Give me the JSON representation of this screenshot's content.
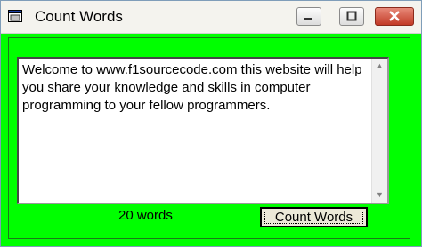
{
  "window": {
    "title": "Count Words"
  },
  "titlebar_buttons": {
    "minimize": "minimize",
    "maximize": "maximize",
    "close": "close"
  },
  "textbox": {
    "value": "Welcome to www.f1sourcecode.com this website will help you share your knowledge and skills in computer programming to your fellow programmers."
  },
  "result": {
    "text": "20 words"
  },
  "button": {
    "label": "Count Words"
  },
  "colors": {
    "client_bg": "#00ff00",
    "close_button": "#c23a26"
  },
  "icons": [
    "app-icon",
    "minimize-icon",
    "maximize-icon",
    "close-icon",
    "scroll-up-icon",
    "scroll-down-icon"
  ]
}
